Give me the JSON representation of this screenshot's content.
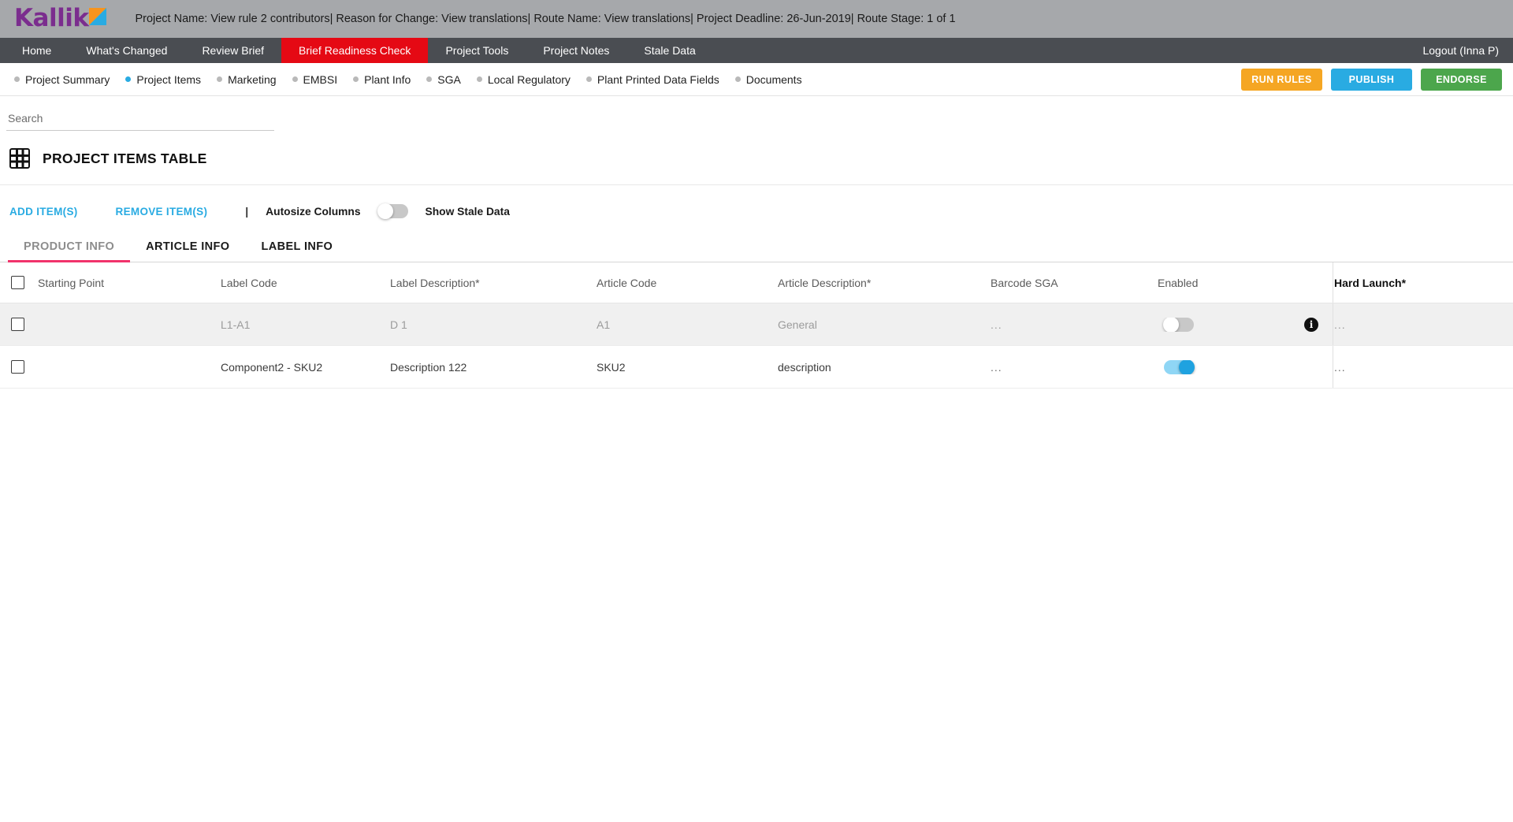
{
  "topbar": {
    "logo_text": "Kallik",
    "project_meta": "Project Name: View rule 2 contributors| Reason for Change: View translations| Route Name: View translations| Project Deadline: 26-Jun-2019| Route Stage: 1 of 1"
  },
  "mainnav": {
    "items": [
      {
        "label": "Home",
        "active": false
      },
      {
        "label": "What's Changed",
        "active": false
      },
      {
        "label": "Review Brief",
        "active": false
      },
      {
        "label": "Brief Readiness Check",
        "active": true
      },
      {
        "label": "Project Tools",
        "active": false
      },
      {
        "label": "Project Notes",
        "active": false
      },
      {
        "label": "Stale Data",
        "active": false
      }
    ],
    "logout": "Logout (Inna P)",
    "active_color": "#e50914"
  },
  "subnav": {
    "items": [
      {
        "label": "Project Summary",
        "active": false
      },
      {
        "label": "Project Items",
        "active": true
      },
      {
        "label": "Marketing",
        "active": false
      },
      {
        "label": "EMBSI",
        "active": false
      },
      {
        "label": "Plant Info",
        "active": false
      },
      {
        "label": "SGA",
        "active": false
      },
      {
        "label": "Local Regulatory",
        "active": false
      },
      {
        "label": "Plant Printed Data Fields",
        "active": false
      },
      {
        "label": "Documents",
        "active": false
      }
    ],
    "buttons": {
      "run_rules": "RUN RULES",
      "publish": "PUBLISH",
      "endorse": "ENDORSE"
    },
    "colors": {
      "run_rules": "#f5a623",
      "publish": "#29abe2",
      "endorse": "#4ca64c",
      "active_dot": "#29abe2"
    }
  },
  "search": {
    "placeholder": "Search",
    "value": ""
  },
  "panel": {
    "title": "PROJECT ITEMS TABLE"
  },
  "toolbar": {
    "add_items": "ADD ITEM(S)",
    "remove_items": "REMOVE ITEM(S)",
    "separator": "|",
    "autosize_columns": "Autosize Columns",
    "autosize_on": false,
    "show_stale_data": "Show Stale Data"
  },
  "tabs": [
    {
      "label": "PRODUCT INFO",
      "active": true
    },
    {
      "label": "ARTICLE INFO",
      "active": false
    },
    {
      "label": "LABEL INFO",
      "active": false
    }
  ],
  "tab_underline_color": "#f1336b",
  "table": {
    "columns": [
      "Starting Point",
      "Label Code",
      "Label Description*",
      "Article Code",
      "Article Description*",
      "Barcode SGA",
      "Enabled",
      "Hard Launch*"
    ],
    "rows": [
      {
        "checked": false,
        "disabled": true,
        "starting_point": "",
        "label_code": "L1-A1",
        "label_description": "D 1",
        "article_code": "A1",
        "article_description": "General",
        "barcode_sga": "...",
        "enabled": false,
        "info": "i",
        "hard_launch": "..."
      },
      {
        "checked": false,
        "disabled": false,
        "starting_point": "",
        "label_code": "Component2 - SKU2",
        "label_description": "Description 122",
        "article_code": "SKU2",
        "article_description": "description",
        "barcode_sga": "...",
        "enabled": true,
        "info": "",
        "hard_launch": "..."
      }
    ]
  }
}
